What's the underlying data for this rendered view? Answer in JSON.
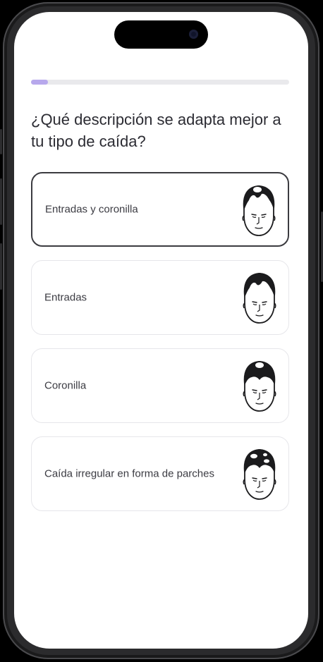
{
  "progress": {
    "value": 0.065,
    "fill_color": "#b7a8ec",
    "track_color": "#e9e9ec"
  },
  "question": "¿Qué descripción se adapta mejor a tu tipo de caída?",
  "options": [
    {
      "label": "Entradas y coronilla",
      "selected": true,
      "icon": "hair-loss-receding-and-crown-icon"
    },
    {
      "label": "Entradas",
      "selected": false,
      "icon": "hair-loss-receding-icon"
    },
    {
      "label": "Coronilla",
      "selected": false,
      "icon": "hair-loss-crown-icon"
    },
    {
      "label": "Caída irregular en forma de parches",
      "selected": false,
      "icon": "hair-loss-patchy-icon"
    }
  ]
}
